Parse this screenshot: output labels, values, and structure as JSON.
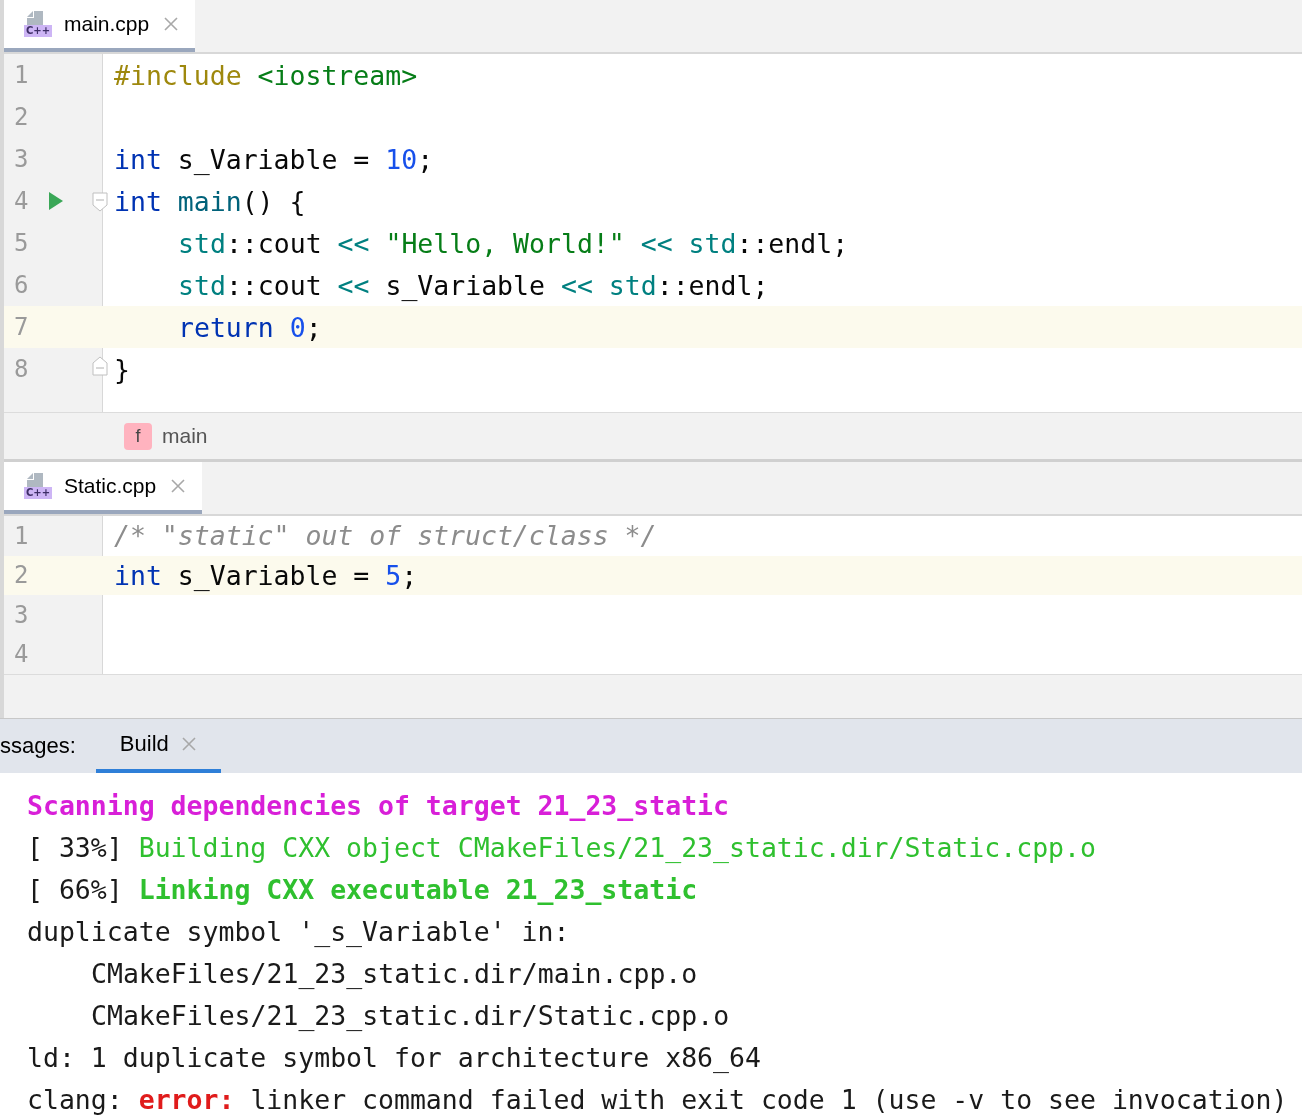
{
  "editors": [
    {
      "tab": {
        "label": "main.cpp",
        "type_badge": "C++",
        "selected": true
      },
      "lines": [
        {
          "number": "1",
          "current": false,
          "indented": false,
          "run": false,
          "fold_start": false,
          "fold_end": false,
          "tokens": [
            {
              "text": "#include ",
              "kind": "directive"
            },
            {
              "text": "<iostream>",
              "kind": "string"
            }
          ]
        },
        {
          "number": "2",
          "current": false,
          "run": false,
          "fold_start": false,
          "fold_end": false
        },
        {
          "number": "3",
          "current": false,
          "indented": false,
          "run": false,
          "fold_start": false,
          "fold_end": false,
          "tokens": [
            {
              "text": "int",
              "kind": "keyword"
            },
            {
              "text": " s_Variable = ",
              "kind": "plain"
            },
            {
              "text": "10",
              "kind": "number"
            },
            {
              "text": ";",
              "kind": "plain"
            }
          ]
        },
        {
          "number": "4",
          "current": false,
          "indented": false,
          "run": true,
          "fold_start": true,
          "fold_end": false,
          "tokens": [
            {
              "text": "int ",
              "kind": "keyword"
            },
            {
              "text": "main",
              "kind": "function"
            },
            {
              "text": "() {",
              "kind": "plain"
            }
          ]
        },
        {
          "number": "5",
          "current": false,
          "indented": true,
          "run": false,
          "fold_start": false,
          "fold_end": false,
          "tokens": [
            {
              "text": "std",
              "kind": "namespace"
            },
            {
              "text": "::cout ",
              "kind": "plain"
            },
            {
              "text": "<< ",
              "kind": "namespace"
            },
            {
              "text": "\"Hello, World!\" ",
              "kind": "string"
            },
            {
              "text": "<< std",
              "kind": "namespace"
            },
            {
              "text": "::endl;",
              "kind": "plain"
            }
          ]
        },
        {
          "number": "6",
          "current": false,
          "indented": true,
          "run": false,
          "fold_start": false,
          "fold_end": false,
          "tokens": [
            {
              "text": "std",
              "kind": "namespace"
            },
            {
              "text": "::cout ",
              "kind": "plain"
            },
            {
              "text": "<<",
              "kind": "namespace"
            },
            {
              "text": " s_Variable ",
              "kind": "plain"
            },
            {
              "text": "<< std",
              "kind": "namespace"
            },
            {
              "text": "::endl;",
              "kind": "plain"
            }
          ]
        },
        {
          "number": "7",
          "current": true,
          "indented": true,
          "run": false,
          "fold_start": false,
          "fold_end": false,
          "tokens": [
            {
              "text": "return ",
              "kind": "keyword"
            },
            {
              "text": "0",
              "kind": "number"
            },
            {
              "text": ";",
              "kind": "plain"
            }
          ]
        },
        {
          "number": "8",
          "current": false,
          "indented": false,
          "run": false,
          "fold_start": false,
          "fold_end": true,
          "tokens": [
            {
              "text": "}",
              "kind": "plain"
            }
          ]
        }
      ],
      "breadcrumb": {
        "badge": "f",
        "label": "main"
      }
    },
    {
      "tab": {
        "label": "Static.cpp",
        "type_badge": "C++",
        "selected": true
      },
      "lines": [
        {
          "number": "1",
          "current": false,
          "indented": false,
          "run": false,
          "fold_start": false,
          "fold_end": false,
          "tokens": [
            {
              "text": "/* \"static\" out of struct/class */",
              "kind": "comment"
            }
          ]
        },
        {
          "number": "2",
          "current": true,
          "indented": false,
          "run": false,
          "fold_start": false,
          "fold_end": false,
          "tokens": [
            {
              "text": "int",
              "kind": "keyword"
            },
            {
              "text": " s_Variable = ",
              "kind": "plain"
            },
            {
              "text": "5",
              "kind": "number"
            },
            {
              "text": ";",
              "kind": "plain"
            }
          ]
        },
        {
          "number": "3",
          "current": false,
          "run": false,
          "fold_start": false,
          "fold_end": false
        },
        {
          "number": "4",
          "current": false,
          "run": false,
          "fold_start": false,
          "fold_end": false
        }
      ]
    }
  ],
  "build_panel": {
    "label": "ssages:",
    "tabs": [
      {
        "label": "Build",
        "selected": true
      }
    ],
    "output": [
      {
        "indented": false,
        "segments": [
          {
            "text": "Scanning dependencies of target 21_23_static",
            "kind": "magenta-bold"
          }
        ]
      },
      {
        "indented": false,
        "segments": [
          {
            "text": "[ 33%] ",
            "kind": "plain"
          },
          {
            "text": "Building CXX object CMakeFiles/21_23_static.dir/Static.cpp.o",
            "kind": "green"
          }
        ]
      },
      {
        "indented": false,
        "segments": [
          {
            "text": "[ 66%] ",
            "kind": "plain"
          },
          {
            "text": "Linking CXX executable 21_23_static",
            "kind": "green-bold"
          }
        ]
      },
      {
        "indented": false,
        "segments": [
          {
            "text": "duplicate symbol '_s_Variable' in:",
            "kind": "plain"
          }
        ]
      },
      {
        "indented": true,
        "segments": [
          {
            "text": "CMakeFiles/21_23_static.dir/main.cpp.o",
            "kind": "plain"
          }
        ]
      },
      {
        "indented": true,
        "segments": [
          {
            "text": "CMakeFiles/21_23_static.dir/Static.cpp.o",
            "kind": "plain"
          }
        ]
      },
      {
        "indented": false,
        "segments": [
          {
            "text": "ld: 1 duplicate symbol for architecture x86_64",
            "kind": "plain"
          }
        ]
      },
      {
        "indented": false,
        "segments": [
          {
            "text": "clang: ",
            "kind": "plain"
          },
          {
            "text": "error:",
            "kind": "error"
          },
          {
            "text": " linker command failed with exit code 1 (use -v to see invocation)",
            "kind": "plain"
          }
        ]
      }
    ]
  }
}
